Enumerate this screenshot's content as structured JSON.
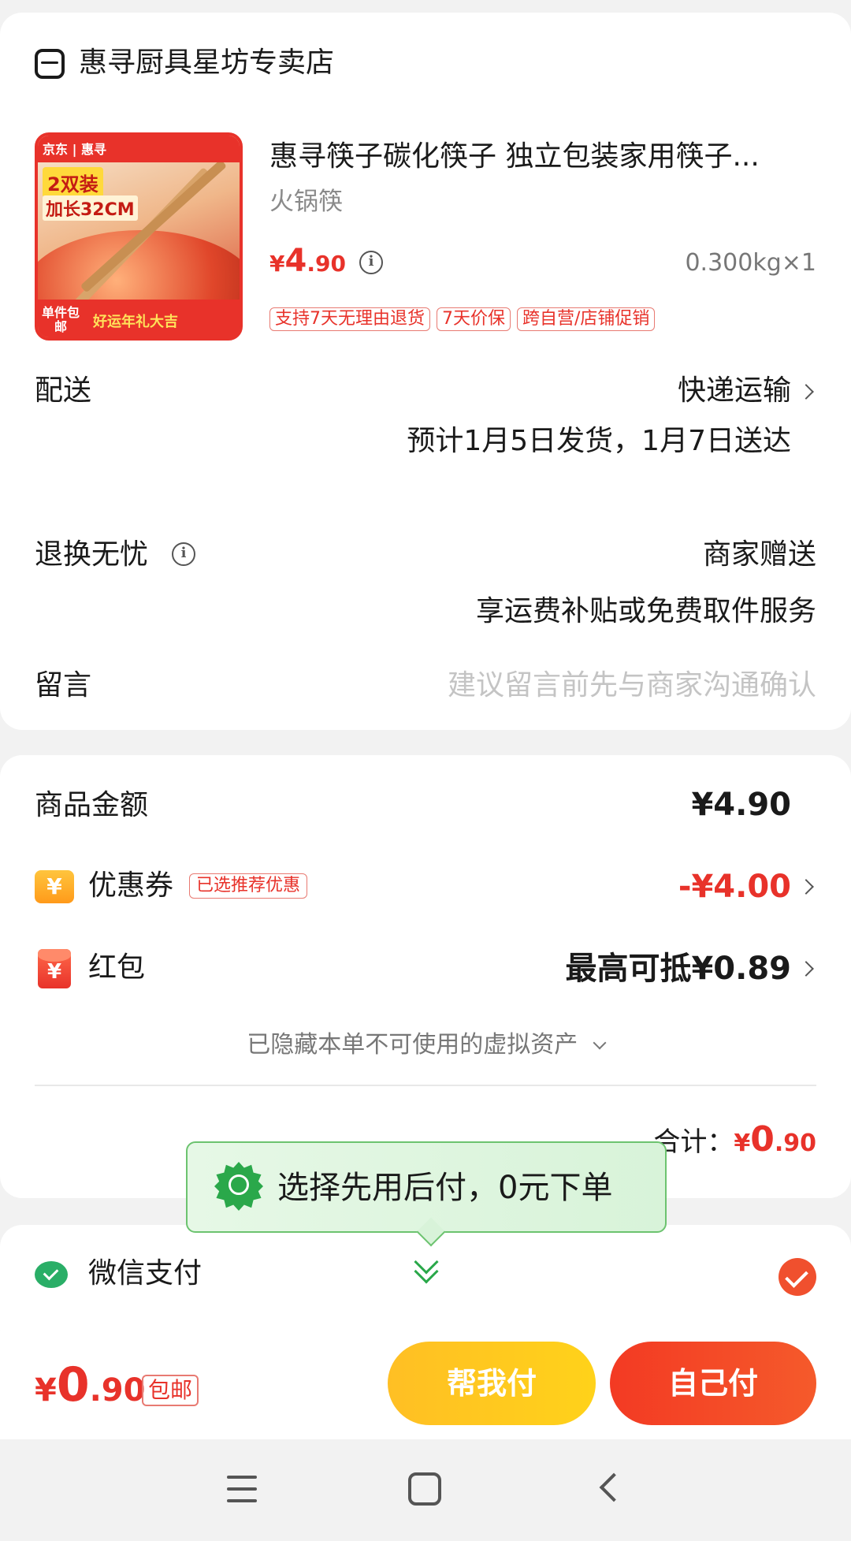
{
  "store": {
    "name": "惠寻厨具星坊专卖店",
    "icon": "store-icon"
  },
  "product": {
    "image_texts": {
      "brand": "京东 | 惠寻",
      "pack": "2双装",
      "length": "加长32CM",
      "shipping": "单件包邮",
      "promo": "好运年礼大吉"
    },
    "title": "惠寻筷子碳化筷子 独立包装家用筷子...",
    "subtitle": "火锅筷",
    "price_symbol": "¥",
    "price_int": "4",
    "price_dec": ".90",
    "quantity": "0.300kg×1",
    "tags": [
      "支持7天无理由退货",
      "7天价保",
      "跨自营/店铺促销"
    ]
  },
  "delivery": {
    "label": "配送",
    "method": "快递运输",
    "eta": "预计1月5日发货，1月7日送达"
  },
  "returns": {
    "label": "退换无忧",
    "value": "商家赠送",
    "detail": "享运费补贴或免费取件服务"
  },
  "message": {
    "label": "留言",
    "placeholder": "建议留言前先与商家沟通确认"
  },
  "summary": {
    "goods_label": "商品金额",
    "goods_amount": "¥4.90",
    "coupon_label": "优惠券",
    "coupon_badge": "已选推荐优惠",
    "coupon_amount": "-¥4.00",
    "hongbao_label": "红包",
    "hongbao_amount": "最高可抵¥0.89",
    "hidden_assets": "已隐藏本单不可使用的虚拟资产",
    "total_label": "合计：",
    "total_symbol": "¥",
    "total_int": "0",
    "total_dec": ".90"
  },
  "tooltip": {
    "text": "选择先用后付，0元下单"
  },
  "payment": {
    "method": "微信支付"
  },
  "action_bar": {
    "price_symbol": "¥",
    "price_int": "0",
    "price_dec": ".90",
    "free_ship": "包邮",
    "help_pay": "帮我付",
    "self_pay": "自己付"
  },
  "colors": {
    "accent_red": "#e8322a",
    "help_yellow": "#ffc61f",
    "wechat_green": "#2aae67"
  }
}
